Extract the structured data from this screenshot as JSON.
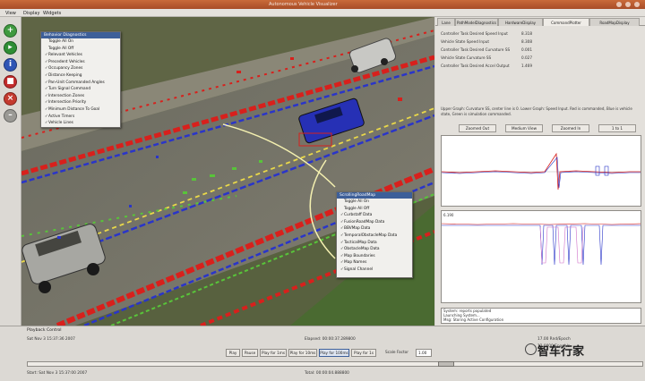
{
  "window": {
    "title": "Autonomous Vehicle Visualizer"
  },
  "menu": {
    "items": [
      "View",
      "Display",
      "Widgets"
    ]
  },
  "colors": {
    "lane_red": "#d8201c",
    "lane_blue": "#2a35c9",
    "lane_green": "#58c43a",
    "lane_yellow": "#e9d84a",
    "menu_header": "#3d5f99"
  },
  "toolbar": {
    "buttons": [
      {
        "icon": "green-plus-icon",
        "color": "#3f9a3f",
        "glyph": "+"
      },
      {
        "icon": "green-arrow-icon",
        "color": "#2e8e35",
        "glyph": "▸"
      },
      {
        "icon": "blue-info-icon",
        "color": "#2f55b5",
        "glyph": "i"
      },
      {
        "icon": "red-stop-icon",
        "color": "#c22b2b",
        "glyph": "■"
      },
      {
        "icon": "red-close-icon",
        "color": "#c43a2f",
        "glyph": "×"
      },
      {
        "icon": "grey-minus-icon",
        "color": "#9a9995",
        "glyph": "–"
      }
    ]
  },
  "behavior_menu": {
    "header": "Behavior Diagnostics",
    "items": [
      {
        "label": "Toggle All On",
        "checked": false
      },
      {
        "label": "Toggle All Off",
        "checked": false
      },
      {
        "label": "Relevant Vehicles",
        "checked": true
      },
      {
        "label": "Precedent Vehicles",
        "checked": true
      },
      {
        "label": "Occupancy Zones",
        "checked": true
      },
      {
        "label": "Distance Keeping",
        "checked": true
      },
      {
        "label": "Pan-Unit Commanded Angles",
        "checked": true
      },
      {
        "label": "Turn Signal Command",
        "checked": true
      },
      {
        "label": "Intersection Zones",
        "checked": true
      },
      {
        "label": "Intersection Priority",
        "checked": true
      },
      {
        "label": "Minimum Distance To Goal",
        "checked": true
      },
      {
        "label": "Active Timers",
        "checked": true
      },
      {
        "label": "Vehicle Lines",
        "checked": true
      }
    ]
  },
  "map_menu": {
    "header": "ScrollingRoadMap",
    "items": [
      {
        "label": "Toggle All On",
        "checked": false
      },
      {
        "label": "Toggle All Off",
        "checked": false
      },
      {
        "label": "Curbstaff Data",
        "checked": true
      },
      {
        "label": "FusionRoadMap Data",
        "checked": true
      },
      {
        "label": "BBVMap Data",
        "checked": true
      },
      {
        "label": "TemporalObstacleMap Data",
        "checked": true
      },
      {
        "label": "TacticalMap Data",
        "checked": true
      },
      {
        "label": "ObstacleMap Data",
        "checked": true
      },
      {
        "label": "Map Boundaries",
        "checked": true
      },
      {
        "label": "Map Names",
        "checked": true
      },
      {
        "label": "Signal Channel",
        "checked": true
      }
    ]
  },
  "right_panel": {
    "tabs": [
      {
        "label": "Lane",
        "active": false
      },
      {
        "label": "PathModelDiagnostics",
        "active": false
      },
      {
        "label": "HardwareDisplay",
        "active": false
      },
      {
        "label": "CommandPlotter",
        "active": true
      },
      {
        "label": "RoadMapDisplay",
        "active": false
      }
    ],
    "fields": [
      {
        "label": "Controller Task Desired Speed Input",
        "value": "8.318"
      },
      {
        "label": "Vehicle State Speed Input",
        "value": "8.308"
      },
      {
        "label": "Controller Task Desired Curvature SS",
        "value": "0.001"
      },
      {
        "label": "Vehicle State Curvature SS",
        "value": "0.027"
      },
      {
        "label": "Controller Task Desired Accel Output",
        "value": "1.469"
      }
    ],
    "caption": "Upper Graph: Curvature SS, center line is 0. Lower Graph: Speed Input. Red is commanded, Blue is vehicle state, Green is simulation commanded.",
    "zoom_buttons": [
      "Zoomed Out",
      "Medium View",
      "Zoomed In",
      "1 to 1"
    ],
    "lower_graph_label": "6.190",
    "log": [
      "System: reports populated",
      "Launching System...",
      "Msg: Storing Active Configuration"
    ]
  },
  "playback": {
    "title": "Playback Control",
    "start_time": "Start: Sat Nov  3 15:37:00 2007",
    "current_time": "Sat Nov  3 15:37:36 2007",
    "elapsed": "Elapsed: 00:00:37.289800",
    "total": "Total: 00:00:04.888800",
    "right_info": "17.00 Rnd/Epoch",
    "right_info2": "12.0000 Epoch/s",
    "buttons": [
      {
        "label": "Play",
        "active": false
      },
      {
        "label": "Pause",
        "active": false
      },
      {
        "label": "Play for 1ms",
        "active": false
      },
      {
        "label": "Play for 10ms",
        "active": false
      },
      {
        "label": "Play for 100ms",
        "active": true
      },
      {
        "label": "Play for 1s",
        "active": false
      }
    ],
    "scale_label": "Scale Factor",
    "scale_value": "1.00",
    "slider_position": 0.66
  },
  "watermark": {
    "text": "智车行家"
  }
}
